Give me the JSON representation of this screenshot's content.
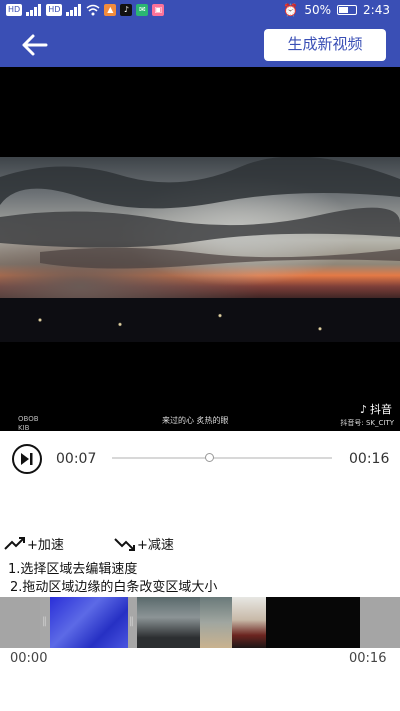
{
  "status_bar": {
    "left_icons": [
      "hd-signal-icon",
      "4g-signal-icon",
      "wifi-icon",
      "app-notification-icons"
    ],
    "alarm_icon": "alarm-icon",
    "battery_percent": "50%",
    "time": "2:43"
  },
  "header": {
    "back_icon": "arrow-left-icon",
    "generate_button": "生成新视频"
  },
  "video": {
    "subtitle": "来过的心 炙热的眼",
    "tiktok_brand": "抖音",
    "tiktok_id": "抖音号: SK_CITY",
    "corner_watermark": "OBOB\nKIB"
  },
  "playback": {
    "current_time": "00:07",
    "total_time": "00:16",
    "progress": 0.44
  },
  "legend": {
    "speed_up": "+加速",
    "slow_down": "+减速"
  },
  "instructions": [
    "1.选择区域去编辑速度",
    "2.拖动区域边缘的白条改变区域大小"
  ],
  "timeline": {
    "start_time": "00:00",
    "end_time": "00:16"
  },
  "colors": {
    "header_blue": "#3a4fb5",
    "video_bg": "#000000",
    "strip_gray": "#a7a7a7"
  }
}
